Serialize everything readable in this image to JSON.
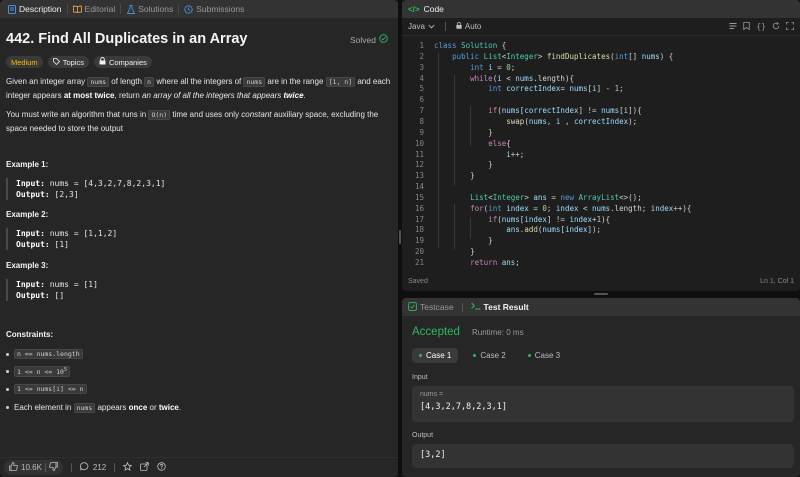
{
  "left": {
    "tabs": [
      {
        "label": "Description",
        "icon": "description-icon"
      },
      {
        "label": "Editorial",
        "icon": "book-icon"
      },
      {
        "label": "Solutions",
        "icon": "flask-icon"
      },
      {
        "label": "Submissions",
        "icon": "history-icon"
      }
    ],
    "title": "442. Find All Duplicates in an Array",
    "solved": "Solved",
    "chips": {
      "difficulty": "Medium",
      "topics": "Topics",
      "companies": "Companies"
    },
    "p1": {
      "a": "Given an integer array ",
      "nums": "nums",
      "b": " of length ",
      "n": "n",
      "c": " where all the integers of ",
      "nums2": "nums",
      "d": " are in the range ",
      "range": "[1, n]",
      "e": " and each",
      "f": "integer appears ",
      "atmost": "at most twice",
      "g": ", return ",
      "arr": "an array of all the integers that appears ",
      "twice": "twice",
      "h": "."
    },
    "p2": {
      "a": "You must write an algorithm that runs in ",
      "on": "O(n)",
      "b": " time and uses only ",
      "constant": "constant",
      "c": " auxiliary space, excluding the",
      "d": "space needed to store the output"
    },
    "examples": [
      {
        "label": "Example 1:",
        "input_label": "Input:",
        "input": "nums = [4,3,2,7,8,2,3,1]",
        "output_label": "Output:",
        "output": "[2,3]"
      },
      {
        "label": "Example 2:",
        "input_label": "Input:",
        "input": "nums = [1,1,2]",
        "output_label": "Output:",
        "output": "[1]"
      },
      {
        "label": "Example 3:",
        "input_label": "Input:",
        "input": "nums = [1]",
        "output_label": "Output:",
        "output": "[]"
      }
    ],
    "constraints_label": "Constraints:",
    "constraints": {
      "c1": "n == nums.length",
      "c2_a": "1 <= n <= 10",
      "c2_sup": "5",
      "c3": "1 <= nums[i] <= n",
      "c4_a": "Each element in ",
      "c4_code": "nums",
      "c4_b": " appears ",
      "c4_once": "once",
      "c4_c": " or ",
      "c4_twice": "twice",
      "c4_d": "."
    },
    "footer": {
      "likes": "10.6K",
      "comments": "212"
    }
  },
  "code": {
    "header": "Code",
    "language": "Java",
    "mode": "Auto",
    "status": "Saved",
    "cursor": "Ln 1, Col 1",
    "lines": [
      [
        {
          "t": "class ",
          "c": "kw"
        },
        {
          "t": "Solution",
          "c": "ty"
        },
        {
          "t": " {",
          "c": ""
        }
      ],
      [
        {
          "t": "    ",
          "c": ""
        },
        {
          "t": "public ",
          "c": "kw"
        },
        {
          "t": "List",
          "c": "ty"
        },
        {
          "t": "<",
          "c": ""
        },
        {
          "t": "Integer",
          "c": "ty"
        },
        {
          "t": "> ",
          "c": ""
        },
        {
          "t": "findDuplicates",
          "c": "fn"
        },
        {
          "t": "(",
          "c": ""
        },
        {
          "t": "int",
          "c": "kw"
        },
        {
          "t": "[] ",
          "c": ""
        },
        {
          "t": "nums",
          "c": "var"
        },
        {
          "t": ") {",
          "c": ""
        }
      ],
      [
        {
          "t": "        ",
          "c": ""
        },
        {
          "t": "int ",
          "c": "kw"
        },
        {
          "t": "i",
          "c": "var"
        },
        {
          "t": " = ",
          "c": ""
        },
        {
          "t": "0",
          "c": "num"
        },
        {
          "t": ";",
          "c": ""
        }
      ],
      [
        {
          "t": "        ",
          "c": ""
        },
        {
          "t": "while",
          "c": "kw2"
        },
        {
          "t": "(",
          "c": ""
        },
        {
          "t": "i",
          "c": "var"
        },
        {
          "t": " < ",
          "c": ""
        },
        {
          "t": "nums",
          "c": "var"
        },
        {
          "t": ".length){",
          "c": ""
        }
      ],
      [
        {
          "t": "            ",
          "c": ""
        },
        {
          "t": "int ",
          "c": "kw"
        },
        {
          "t": "correctIndex",
          "c": "var"
        },
        {
          "t": "= ",
          "c": ""
        },
        {
          "t": "nums",
          "c": "var"
        },
        {
          "t": "[",
          "c": ""
        },
        {
          "t": "i",
          "c": "var"
        },
        {
          "t": "] - ",
          "c": ""
        },
        {
          "t": "1",
          "c": "num"
        },
        {
          "t": ";",
          "c": ""
        }
      ],
      [
        {
          "t": "",
          "c": ""
        }
      ],
      [
        {
          "t": "            ",
          "c": ""
        },
        {
          "t": "if",
          "c": "kw2"
        },
        {
          "t": "(",
          "c": ""
        },
        {
          "t": "nums",
          "c": "var"
        },
        {
          "t": "[",
          "c": ""
        },
        {
          "t": "correctIndex",
          "c": "var"
        },
        {
          "t": "] != ",
          "c": ""
        },
        {
          "t": "nums",
          "c": "var"
        },
        {
          "t": "[",
          "c": ""
        },
        {
          "t": "i",
          "c": "var"
        },
        {
          "t": "]){",
          "c": ""
        }
      ],
      [
        {
          "t": "                ",
          "c": ""
        },
        {
          "t": "swap",
          "c": "fn"
        },
        {
          "t": "(",
          "c": ""
        },
        {
          "t": "nums",
          "c": "var"
        },
        {
          "t": ", ",
          "c": ""
        },
        {
          "t": "i",
          "c": "var"
        },
        {
          "t": " , ",
          "c": ""
        },
        {
          "t": "correctIndex",
          "c": "var"
        },
        {
          "t": ");",
          "c": ""
        }
      ],
      [
        {
          "t": "            }",
          "c": ""
        }
      ],
      [
        {
          "t": "            ",
          "c": ""
        },
        {
          "t": "else",
          "c": "kw2"
        },
        {
          "t": "{",
          "c": ""
        }
      ],
      [
        {
          "t": "                ",
          "c": ""
        },
        {
          "t": "i",
          "c": "var"
        },
        {
          "t": "++;",
          "c": ""
        }
      ],
      [
        {
          "t": "            }",
          "c": ""
        }
      ],
      [
        {
          "t": "        }",
          "c": ""
        }
      ],
      [
        {
          "t": "",
          "c": ""
        }
      ],
      [
        {
          "t": "        ",
          "c": ""
        },
        {
          "t": "List",
          "c": "ty"
        },
        {
          "t": "<",
          "c": ""
        },
        {
          "t": "Integer",
          "c": "ty"
        },
        {
          "t": "> ",
          "c": ""
        },
        {
          "t": "ans",
          "c": "var"
        },
        {
          "t": " = ",
          "c": ""
        },
        {
          "t": "new ",
          "c": "kw"
        },
        {
          "t": "ArrayList",
          "c": "ty"
        },
        {
          "t": "<>();",
          "c": ""
        }
      ],
      [
        {
          "t": "        ",
          "c": ""
        },
        {
          "t": "for",
          "c": "kw2"
        },
        {
          "t": "(",
          "c": ""
        },
        {
          "t": "int ",
          "c": "kw"
        },
        {
          "t": "index",
          "c": "var"
        },
        {
          "t": " = ",
          "c": ""
        },
        {
          "t": "0",
          "c": "num"
        },
        {
          "t": "; ",
          "c": ""
        },
        {
          "t": "index",
          "c": "var"
        },
        {
          "t": " < ",
          "c": ""
        },
        {
          "t": "nums",
          "c": "var"
        },
        {
          "t": ".length; ",
          "c": ""
        },
        {
          "t": "index",
          "c": "var"
        },
        {
          "t": "++){",
          "c": ""
        }
      ],
      [
        {
          "t": "            ",
          "c": ""
        },
        {
          "t": "if",
          "c": "kw2"
        },
        {
          "t": "(",
          "c": ""
        },
        {
          "t": "nums",
          "c": "var"
        },
        {
          "t": "[",
          "c": ""
        },
        {
          "t": "index",
          "c": "var"
        },
        {
          "t": "] != ",
          "c": ""
        },
        {
          "t": "index",
          "c": "var"
        },
        {
          "t": "+",
          "c": ""
        },
        {
          "t": "1",
          "c": "num"
        },
        {
          "t": "){",
          "c": ""
        }
      ],
      [
        {
          "t": "                ",
          "c": ""
        },
        {
          "t": "ans",
          "c": "var"
        },
        {
          "t": ".",
          "c": ""
        },
        {
          "t": "add",
          "c": "fn"
        },
        {
          "t": "(",
          "c": ""
        },
        {
          "t": "nums",
          "c": "var"
        },
        {
          "t": "[",
          "c": ""
        },
        {
          "t": "index",
          "c": "var"
        },
        {
          "t": "]);",
          "c": ""
        }
      ],
      [
        {
          "t": "            }",
          "c": ""
        }
      ],
      [
        {
          "t": "        }",
          "c": ""
        }
      ],
      [
        {
          "t": "        ",
          "c": ""
        },
        {
          "t": "return ",
          "c": "kw2"
        },
        {
          "t": "ans",
          "c": "var"
        },
        {
          "t": ";",
          "c": ""
        }
      ]
    ]
  },
  "result": {
    "tabs": {
      "testcase": "Testcase",
      "result": "Test Result"
    },
    "verdict": "Accepted",
    "runtime": "Runtime: 0 ms",
    "cases": [
      "Case 1",
      "Case 2",
      "Case 3"
    ],
    "input_label": "Input",
    "input_var": "nums =",
    "input_value": "[4,3,2,7,8,2,3,1]",
    "output_label": "Output",
    "output_value": "[3,2]"
  },
  "colors": {
    "accent_green": "#2cbb5d",
    "medium": "#ffb800",
    "bg": "#0f0f0f",
    "panel": "#262626",
    "editor": "#1e1e1e"
  }
}
